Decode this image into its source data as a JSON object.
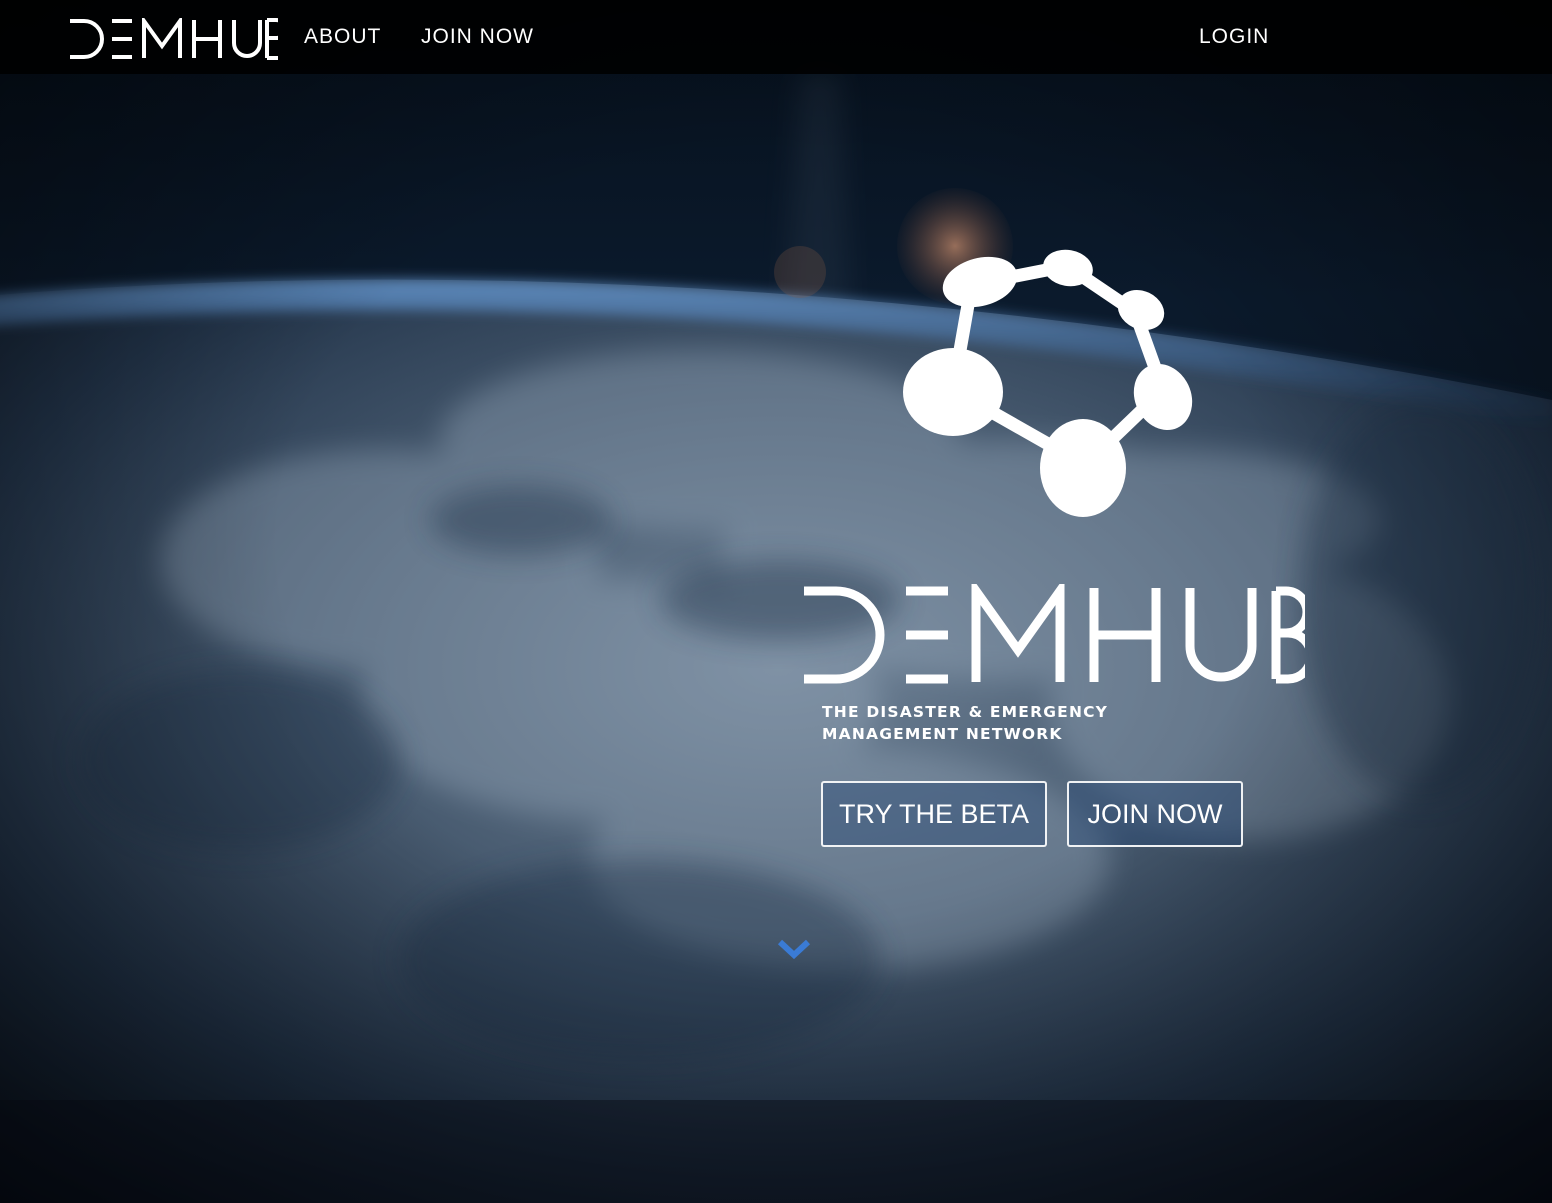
{
  "nav": {
    "brand": "DEMHUB",
    "links": [
      {
        "label": "ABOUT"
      },
      {
        "label": "JOIN NOW"
      }
    ],
    "login_label": "LOGIN"
  },
  "hero": {
    "wordmark": "DEMHUB",
    "tagline": "THE DISASTER & EMERGENCY MANAGEMENT NETWORK",
    "buttons": [
      {
        "label": "TRY THE BETA"
      },
      {
        "label": "JOIN NOW"
      }
    ],
    "scroll_icon": "chevron-down-icon"
  },
  "colors": {
    "nav_bg": "#000000",
    "text": "#ffffff",
    "accent": "#3a7bd5",
    "button_fill": "#234673"
  }
}
